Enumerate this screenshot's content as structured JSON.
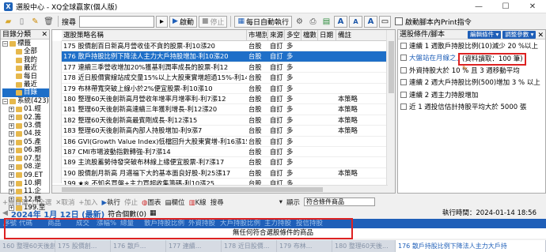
{
  "window": {
    "title": "選股中心 - XQ全球贏家(個人版)",
    "min": "—",
    "max": "☐",
    "close": "✕"
  },
  "toolbar": {
    "search_label": "搜尋",
    "search_value": "",
    "start_label": "啟動",
    "stop_label": "停止",
    "auto_run_label": "每日自動執行",
    "print_checkbox_label": "啟動腳本內Print指令"
  },
  "left_panel": {
    "header": "目錄分類",
    "items": [
      {
        "toggle": "−",
        "label": "標籤"
      },
      {
        "toggle": "",
        "label": "全部"
      },
      {
        "toggle": "",
        "label": "我的"
      },
      {
        "toggle": "",
        "label": "最近"
      },
      {
        "toggle": "",
        "label": "每日"
      },
      {
        "toggle": "",
        "label": "最近"
      },
      {
        "toggle": "",
        "label": "目錄",
        "selected": true
      },
      {
        "toggle": "−",
        "label": "系統(423)"
      },
      {
        "toggle": "+",
        "label": "01.經"
      },
      {
        "toggle": "+",
        "label": "02.籌"
      },
      {
        "toggle": "+",
        "label": "03.價"
      },
      {
        "toggle": "+",
        "label": "04.技"
      },
      {
        "toggle": "+",
        "label": "05.產"
      },
      {
        "toggle": "+",
        "label": "06.期"
      },
      {
        "toggle": "+",
        "label": "07.型"
      },
      {
        "toggle": "+",
        "label": "08.逆"
      },
      {
        "toggle": "+",
        "label": "09.ET"
      },
      {
        "toggle": "+",
        "label": "10.網"
      },
      {
        "toggle": "+",
        "label": "11.企"
      },
      {
        "toggle": "+",
        "label": "12.精"
      },
      {
        "toggle": "+",
        "label": "199.至"
      }
    ]
  },
  "strategy_table": {
    "columns": [
      "選股策略名稱",
      "市場別",
      "來源",
      "多空",
      "檔數",
      "日期",
      "備註"
    ],
    "rows": [
      {
        "name": "175 股價創百日新高月營收佳不貪的股票-利10漲20",
        "market": "台股",
        "source": "自訂",
        "ls": "多",
        "count": "",
        "date": "",
        "note": "",
        "selected": false
      },
      {
        "name": "176 散戶持股比例下降法人主力大戶持股增加-利10漲20",
        "market": "台股",
        "source": "自訂",
        "ls": "多",
        "count": "",
        "date": "",
        "note": "",
        "selected": true
      },
      {
        "name": "177 連續三季營收增加20%獲基利潤率成長的股票-利12",
        "market": "台股",
        "source": "自訂",
        "ls": "多",
        "count": "",
        "date": "",
        "note": "",
        "selected": false
      },
      {
        "name": "178 近日股價實線站成交量15%以上大股東實增超過15%-利14漲15",
        "market": "台股",
        "source": "自訂",
        "ls": "多",
        "count": "",
        "date": "",
        "note": "",
        "selected": false
      },
      {
        "name": "179 布林帶寬突破上線小於2%便宜股票-利10漲10",
        "market": "台股",
        "source": "自訂",
        "ls": "多",
        "count": "",
        "date": "",
        "note": "",
        "selected": false
      },
      {
        "name": "180 整理60天後創新高月營收年增率月增率利-利7漲12",
        "market": "台股",
        "source": "自訂",
        "ls": "多",
        "count": "",
        "date": "",
        "note": "本策略",
        "selected": false
      },
      {
        "name": "181 整理60天後創新高連續三年獲利增長-利12漲20",
        "market": "台股",
        "source": "自訂",
        "ls": "多",
        "count": "",
        "date": "",
        "note": "本策略",
        "selected": false
      },
      {
        "name": "182 整理60天後創新高最賓剛成長-利12漲15",
        "market": "台股",
        "source": "自訂",
        "ls": "多",
        "count": "",
        "date": "",
        "note": "本策略",
        "selected": false
      },
      {
        "name": "183 整理60天後創新高內部人持股增加-利9漲7",
        "market": "台股",
        "source": "自訂",
        "ls": "多",
        "count": "",
        "date": "",
        "note": "本策略",
        "selected": false
      },
      {
        "name": "186 GVI(Growth Value Index)低檔回升大股東實增-利16漲15",
        "market": "台股",
        "source": "自訂",
        "ls": "多",
        "count": "",
        "date": "",
        "note": "",
        "selected": false
      },
      {
        "name": "187 CMI市場波動指數轉強-利7漲14",
        "market": "台股",
        "source": "自訂",
        "ls": "多",
        "count": "",
        "date": "",
        "note": "",
        "selected": false
      },
      {
        "name": "189 主流股蓄勢待發突破布林線上緣便宜股票-利7漲17",
        "market": "台股",
        "source": "自訂",
        "ls": "多",
        "count": "",
        "date": "",
        "note": "",
        "selected": false
      },
      {
        "name": "190 股價創月新高 月邁福下大的基本面良好股-利25漲17",
        "market": "台股",
        "source": "自訂",
        "ls": "多",
        "count": "",
        "date": "",
        "note": "本策略",
        "selected": false
      },
      {
        "name": "199 ★※ 不知名買盤+主力買超收集籌碼-利10漲25",
        "market": "台股",
        "source": "自訂",
        "ls": "多",
        "count": "",
        "date": "",
        "note": "",
        "selected": false
      }
    ]
  },
  "right_panel": {
    "header": "選股條件/腳本",
    "btn_edit": "編輯條件 ▾",
    "btn_adjust": "調整參數 ▾",
    "close": "✕",
    "conditions": [
      {
        "label": "連續 1 週散戶持股比例(10)減少 20 %以上",
        "sub": false
      },
      {
        "label": "大盤站在月線之上",
        "sub": true
      },
      {
        "label": "外資持股大於 10 % 且 3 週移動平均",
        "sub": false
      },
      {
        "label": "連續 2 週大戶持股比例(500)增加 3 % 以上",
        "sub": false
      },
      {
        "label": "連續 2 週主力持股增加",
        "sub": false
      },
      {
        "label": "近 1 週投信估計持股平均大於 5000 張",
        "sub": false
      }
    ],
    "highlight_box": "(資料讀取：100 筆)"
  },
  "bottom_toolbar": {
    "add": "+加自選",
    "all": "☐全選",
    "clear": "✕取消",
    "add2": "+加入",
    "exec": "執行",
    "stop": "停止",
    "chart": "圖表",
    "column": "欄位",
    "kline": "K線",
    "search": "搜尋",
    "display_label": "顯示",
    "display_value": "符合條件商品"
  },
  "date_bar": {
    "date": "2024年 1月 12日 (最新)",
    "match": "符合個數(0)",
    "exec_time_label": "執行時間：",
    "exec_time": "2024-01-14 18:56"
  },
  "result_table": {
    "columns": [
      "序號",
      "代碼",
      "商品",
      "成交",
      "漲幅%",
      "總量",
      "散戶持股比例",
      "外資持股",
      "大戶持股比例",
      "主力持股",
      "投信持股"
    ],
    "empty_msg": "無任何符合選股條件的商品"
  },
  "status_tabs": [
    "160 整理60天後創新高...",
    "175 股價創...",
    "176 散戶...",
    "177 連續...",
    "178 近日股價...",
    "179 布林...",
    "180 整理60天後...",
    "176 散戶持股比例下降法人主力大戶持"
  ]
}
